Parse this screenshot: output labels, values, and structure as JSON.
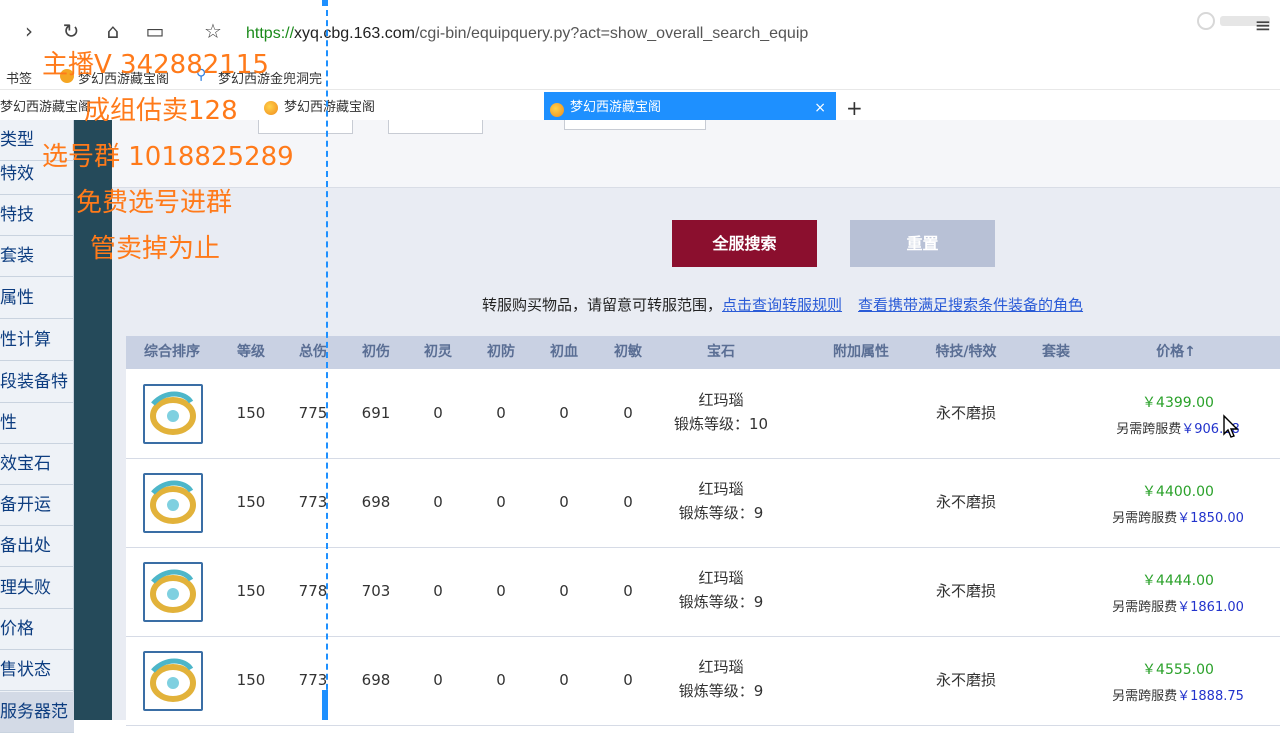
{
  "browser": {
    "url_scheme": "https://",
    "url_host": "xyq.cbg.163.com",
    "url_path": "/cgi-bin/equipquery.py?act=show_overall_search_equip",
    "bookmarks": [
      "书签",
      "梦幻西游藏宝阁",
      "梦幻西游金兜洞完"
    ],
    "tabs": [
      "梦幻西游藏宝阁",
      "梦幻西游藏宝阁"
    ],
    "active_tab": "梦幻西游藏宝阁",
    "active_tab_close": "×",
    "new_tab": "+"
  },
  "sidebar": {
    "items": [
      "类型",
      "特效",
      "特技",
      "套装",
      "属性",
      "性计算",
      "段装备特",
      "性",
      "效宝石",
      "备开运",
      "备出处",
      "理失败",
      "价格",
      "售状态",
      "服务器范"
    ]
  },
  "overlay": {
    "line1": "主播V 342882115",
    "line2": "成组估卖128",
    "line3": "选号群 1018825289",
    "line4": "免费选号进群",
    "line5": "管卖掉为止"
  },
  "buttons": {
    "search": "全服搜索",
    "reset": "重置"
  },
  "notice": {
    "text": "转服购买物品，请留意可转服范围，",
    "link1": "点击查询转服规则",
    "link2": "查看携带满足搜索条件装备的角色"
  },
  "table": {
    "headers": [
      "综合排序",
      "等级",
      "总伤",
      "初伤",
      "初灵",
      "初防",
      "初血",
      "初敏",
      "宝石",
      "附加属性",
      "特技/特效",
      "套装",
      "价格↑"
    ],
    "rows": [
      {
        "level": "150",
        "total": "775",
        "init_dmg": "691",
        "ling": "0",
        "def": "0",
        "hp": "0",
        "agi": "0",
        "gem": "红玛瑙",
        "forge": "锻炼等级：10",
        "effect": "永不磨损",
        "price": "￥4399.00",
        "extra_label": "另需跨服费",
        "extra": "￥906.38"
      },
      {
        "level": "150",
        "total": "773",
        "init_dmg": "698",
        "ling": "0",
        "def": "0",
        "hp": "0",
        "agi": "0",
        "gem": "红玛瑙",
        "forge": "锻炼等级：9",
        "effect": "永不磨损",
        "price": "￥4400.00",
        "extra_label": "另需跨服费",
        "extra": "￥1850.00"
      },
      {
        "level": "150",
        "total": "778",
        "init_dmg": "703",
        "ling": "0",
        "def": "0",
        "hp": "0",
        "agi": "0",
        "gem": "红玛瑙",
        "forge": "锻炼等级：9",
        "effect": "永不磨损",
        "price": "￥4444.00",
        "extra_label": "另需跨服费",
        "extra": "￥1861.00"
      },
      {
        "level": "150",
        "total": "773",
        "init_dmg": "698",
        "ling": "0",
        "def": "0",
        "hp": "0",
        "agi": "0",
        "gem": "红玛瑙",
        "forge": "锻炼等级：9",
        "effect": "永不磨损",
        "price": "￥4555.00",
        "extra_label": "另需跨服费",
        "extra": "￥1888.75"
      }
    ]
  },
  "colors": {
    "search_button": "#8b0f2e",
    "reset_button": "#b8c1d6",
    "active_tab": "#1e90ff",
    "overlay_text": "#ff7a1a",
    "price_green": "#2aa12a"
  }
}
